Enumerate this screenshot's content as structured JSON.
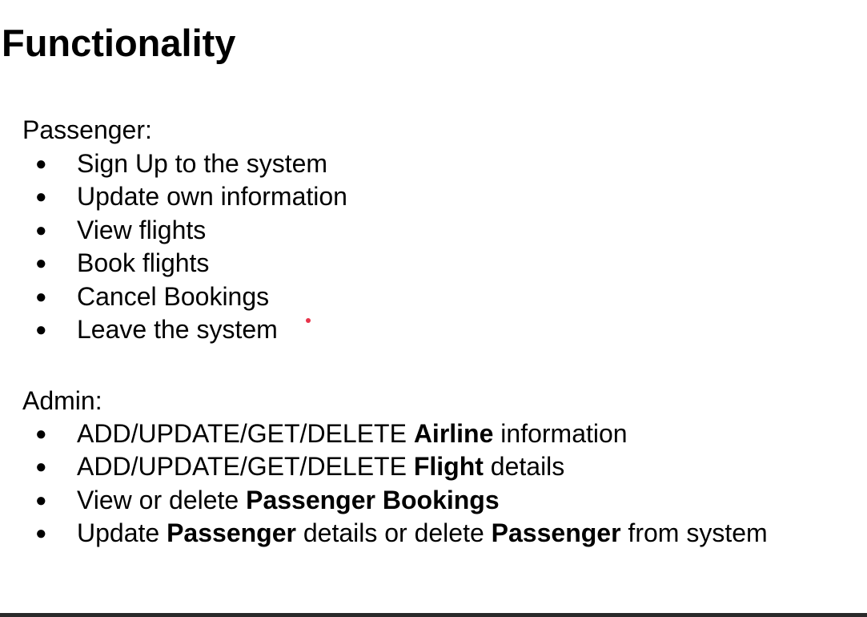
{
  "title": "Functionality",
  "colors": {
    "cursor_dot": "#e8334a",
    "bottom_bar": "#2a2a2a"
  },
  "bullet_glyph": "●",
  "passenger": {
    "heading": "Passenger:",
    "items": [
      [
        {
          "text": "Sign Up to the system",
          "bold": false
        }
      ],
      [
        {
          "text": "Update own information",
          "bold": false
        }
      ],
      [
        {
          "text": "View flights",
          "bold": false
        }
      ],
      [
        {
          "text": "Book flights",
          "bold": false
        }
      ],
      [
        {
          "text": "Cancel Bookings",
          "bold": false
        }
      ],
      [
        {
          "text": "Leave the system",
          "bold": false
        }
      ]
    ]
  },
  "admin": {
    "heading": "Admin:",
    "items": [
      [
        {
          "text": "ADD/UPDATE/GET/DELETE ",
          "bold": false
        },
        {
          "text": "Airline",
          "bold": true
        },
        {
          "text": " information",
          "bold": false
        }
      ],
      [
        {
          "text": "ADD/UPDATE/GET/DELETE ",
          "bold": false
        },
        {
          "text": "Flight",
          "bold": true
        },
        {
          "text": " details",
          "bold": false
        }
      ],
      [
        {
          "text": "View or delete ",
          "bold": false
        },
        {
          "text": "Passenger Bookings",
          "bold": true
        }
      ],
      [
        {
          "text": "Update ",
          "bold": false
        },
        {
          "text": "Passenger",
          "bold": true
        },
        {
          "text": " details or delete ",
          "bold": false
        },
        {
          "text": "Passenger",
          "bold": true
        },
        {
          "text": " from system",
          "bold": false
        }
      ]
    ]
  }
}
